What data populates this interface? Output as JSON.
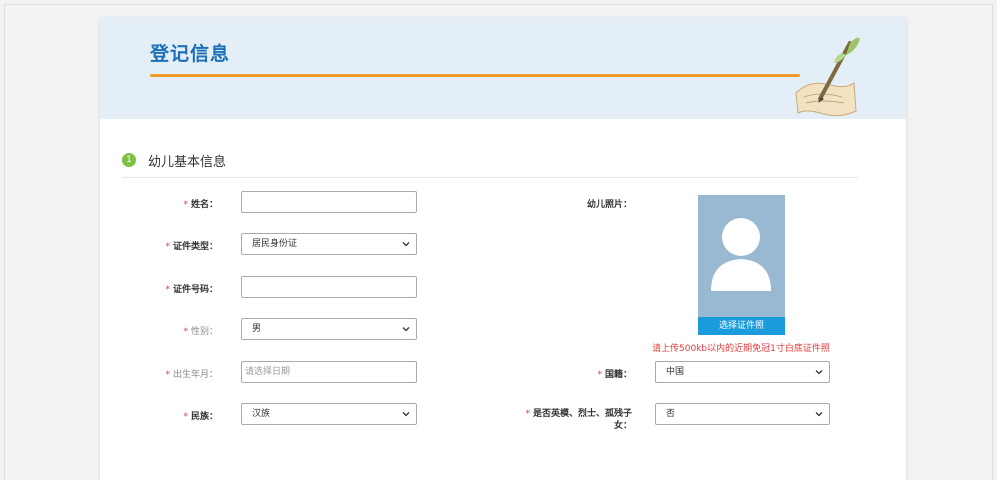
{
  "header": {
    "title": "登记信息"
  },
  "section": {
    "step": "1",
    "title": "幼儿基本信息"
  },
  "form": {
    "name": {
      "label": "姓名："
    },
    "id_type": {
      "label": "证件类型：",
      "value": "居民身份证"
    },
    "id_number": {
      "label": "证件号码："
    },
    "gender": {
      "label": "性别：",
      "value": "男"
    },
    "birth": {
      "label": "出生年月：",
      "placeholder": "请选择日期"
    },
    "ethnicity": {
      "label": "民族：",
      "value": "汉族"
    },
    "nationality": {
      "label": "国籍：",
      "value": "中国"
    },
    "hero_orphan": {
      "label_line1": "是否英模、烈士、孤残子",
      "label_line2": "女：",
      "value": "否"
    },
    "required_mark": "*"
  },
  "photo": {
    "label": "幼儿照片：",
    "button": "选择证件照",
    "hint": "请上传500kb以内的近期免冠1寸白底证件照"
  },
  "colors": {
    "accent": "#1d6fb8",
    "orange": "#f09a2b",
    "required": "#e23b3b",
    "step": "#7cc142",
    "photo_bg": "#99b9d2",
    "photo_btn": "#1a9bdc"
  }
}
